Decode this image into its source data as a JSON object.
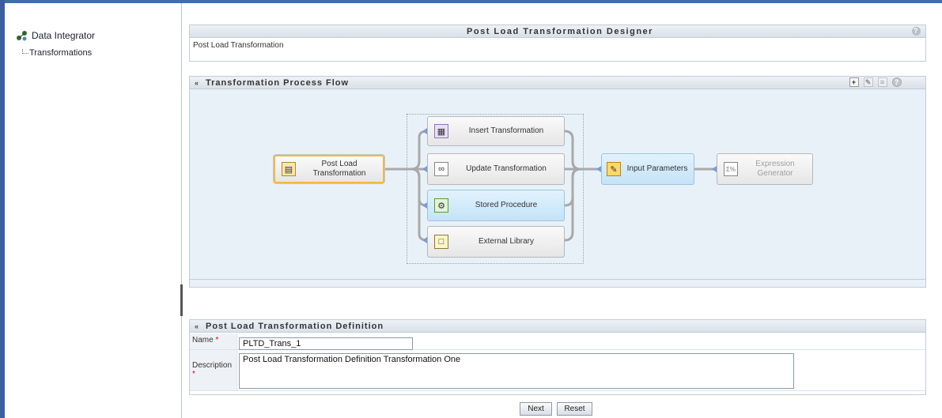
{
  "sidebar": {
    "root_label": "Data Integrator",
    "child_label": "Transformations"
  },
  "designer": {
    "title": "Post Load Transformation Designer",
    "subtitle": "Post Load Transformation",
    "help_glyph": "?"
  },
  "flow": {
    "title": "Transformation Process Flow",
    "collapse_glyph": "«",
    "nodes": {
      "start": "Post Load\nTransformation",
      "insert": "Insert Transformation",
      "update": "Update Transformation",
      "stored": "Stored Procedure",
      "external": "External Library",
      "input": "Input Parameters",
      "expression": "Expression\nGenerator"
    },
    "tools": [
      "add-icon",
      "edit-icon",
      "list-icon",
      "help-icon"
    ]
  },
  "definition": {
    "title": "Post Load Transformation Definition",
    "name_label": "Name",
    "name_value": "PLTD_Trans_1",
    "description_label": "Description",
    "description_value": "Post Load Transformation Definition Transformation One",
    "required_mark": "*"
  },
  "buttons": {
    "next": "Next",
    "reset": "Reset"
  },
  "colors": {
    "accent": "#3f6fa8",
    "selected_border": "#f4b74a",
    "node_blue": "#c4e3f6"
  }
}
